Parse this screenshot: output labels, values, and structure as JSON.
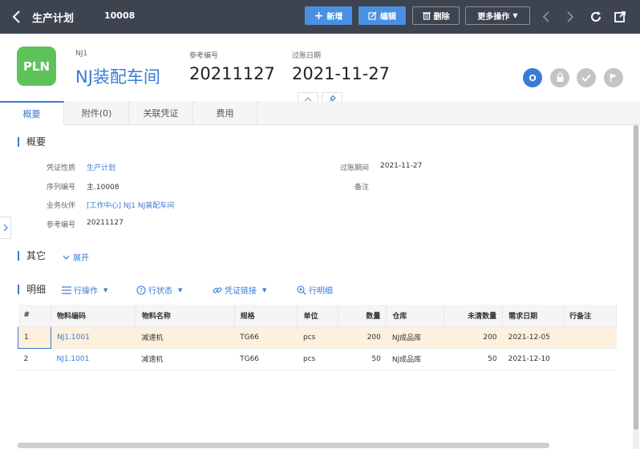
{
  "topbar": {
    "title": "生产计划",
    "doc_number": "10008",
    "buttons": {
      "new": "新增",
      "edit": "编辑",
      "delete": "删除",
      "more": "更多操作"
    }
  },
  "header": {
    "logo_text": "PLN",
    "code_label": "NJ1",
    "code_value": "NJ装配车间",
    "ref_label": "参考编号",
    "ref_value": "20211127",
    "date_label": "过账日期",
    "date_value": "2021-11-27",
    "status_letter": "O"
  },
  "tabs": [
    "概要",
    "附件(0)",
    "关联凭证",
    "费用"
  ],
  "overview": {
    "title": "概要",
    "fields": [
      {
        "label": "凭证性质",
        "value": "生产计划"
      },
      {
        "label": "序列编号",
        "value": "主.10008"
      },
      {
        "label": "业务伙伴",
        "value": "[工作中心] NJ1 NJ装配车间"
      },
      {
        "label": "参考编号",
        "value": "20211127"
      }
    ],
    "right_fields": [
      {
        "label": "过账期间",
        "value": "2021-11-27"
      },
      {
        "label": "备注",
        "value": ""
      }
    ]
  },
  "other": {
    "title": "其它",
    "expand_label": "展开"
  },
  "detail": {
    "title": "明细",
    "ops": {
      "line_ops": "行操作",
      "line_status": "行状态",
      "doc_link": "凭证链接",
      "line_detail": "行明细"
    },
    "columns": [
      "#",
      "物料编码",
      "物料名称",
      "规格",
      "单位",
      "数量",
      "仓库",
      "未清数量",
      "需求日期",
      "行备注"
    ],
    "rows": [
      [
        "1",
        "NJ1.1001",
        "减速机",
        "TG66",
        "pcs",
        "200",
        "NJ成品库",
        "200",
        "2021-12-05",
        ""
      ],
      [
        "2",
        "NJ1.1001",
        "减速机",
        "TG66",
        "pcs",
        "50",
        "NJ成品库",
        "50",
        "2021-12-10",
        ""
      ]
    ]
  },
  "colors": {
    "topbar": "#3d4450",
    "primary": "#4a90e2",
    "logo": "#5ec25a",
    "link": "#3a7bd5",
    "selected_row": "#fdf0dc"
  }
}
